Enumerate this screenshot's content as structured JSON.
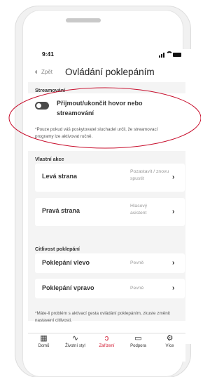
{
  "status": {
    "time": "9:41"
  },
  "nav": {
    "back_label": "Zpět",
    "title": "Ovládání poklepáním"
  },
  "streaming": {
    "section": "Streamování",
    "toggle_label": "Přijmout/ukončit hovor nebo streamování",
    "toggle_on": false,
    "note": "*Pouze pokud váš poskytovatel sluchadel určil, že streamovací programy lze aktivovat ručně."
  },
  "custom_actions": {
    "section": "Vlastní akce",
    "items": [
      {
        "label": "Levá strana",
        "value": "Pozastavit / znovu spustit"
      },
      {
        "label": "Pravá strana",
        "value": "Hlasový asistent"
      }
    ]
  },
  "sensitivity": {
    "section": "Citlivost poklepání",
    "items": [
      {
        "label": "Poklepání vlevo",
        "value": "Pevně"
      },
      {
        "label": "Poklepání vpravo",
        "value": "Pevně"
      }
    ],
    "note": "*Máte-li problém s aktivací gesta ovládání poklepáním, zkuste změnit nastavení citlivosti."
  },
  "tabbar": {
    "tabs": [
      {
        "label": "Domů",
        "icon": "grid-icon",
        "glyph": "▦",
        "active": false
      },
      {
        "label": "Životní styl",
        "icon": "pulse-icon",
        "glyph": "∿",
        "active": false
      },
      {
        "label": "Zařízení",
        "icon": "hearing-aid-icon",
        "glyph": "ↄ",
        "active": true
      },
      {
        "label": "Podpora",
        "icon": "chat-icon",
        "glyph": "▭",
        "active": false
      },
      {
        "label": "Více",
        "icon": "gear-icon",
        "glyph": "⚙",
        "active": false
      }
    ]
  },
  "colors": {
    "accent": "#d0142c",
    "annotation": "#c8102e"
  }
}
